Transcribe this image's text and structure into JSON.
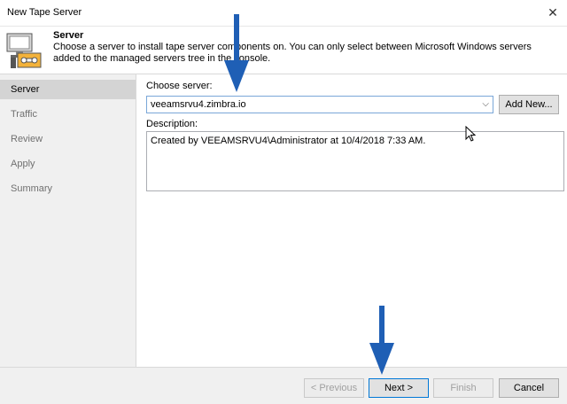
{
  "window": {
    "title": "New Tape Server",
    "close_glyph": "✕"
  },
  "header": {
    "title": "Server",
    "description": "Choose a server to install tape server components on. You can only select between Microsoft Windows servers added to the managed servers tree in the console.",
    "icon": "tape-server-icon"
  },
  "sidebar": {
    "steps": [
      {
        "label": "Server",
        "active": true
      },
      {
        "label": "Traffic",
        "active": false
      },
      {
        "label": "Review",
        "active": false
      },
      {
        "label": "Apply",
        "active": false
      },
      {
        "label": "Summary",
        "active": false
      }
    ]
  },
  "main": {
    "choose_server_label": "Choose server:",
    "server_value": "veeamsrvu4.zimbra.io",
    "dropdown_glyph": "⌵",
    "add_new_label": "Add New...",
    "description_label": "Description:",
    "description_text": "Created by VEEAMSRVU4\\Administrator at 10/4/2018 7:33 AM."
  },
  "footer": {
    "previous_label": "< Previous",
    "next_label": "Next >",
    "finish_label": "Finish",
    "cancel_label": "Cancel"
  },
  "colors": {
    "annotation_arrow": "#1f5fb5",
    "active_step_bg": "#d4d4d4",
    "combo_border": "#7aa7d8"
  }
}
